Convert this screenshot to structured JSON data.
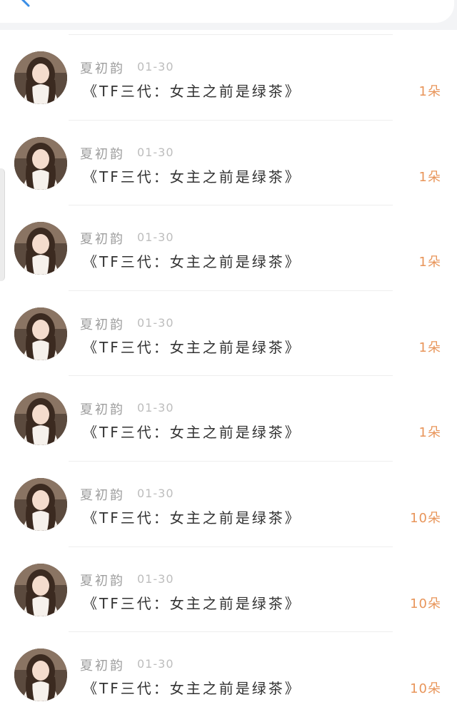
{
  "colors": {
    "accent_orange": "#e8955a",
    "name_gray": "#9e9e9e",
    "title_dark": "#333333",
    "back_arrow_blue": "#3a8ee6"
  },
  "icons": {
    "back": "back-arrow-icon"
  },
  "items": [
    {
      "username": "夏初韵",
      "date": "01-30",
      "title": "《TF三代：女主之前是绿茶》",
      "count": "1朵"
    },
    {
      "username": "夏初韵",
      "date": "01-30",
      "title": "《TF三代：女主之前是绿茶》",
      "count": "1朵"
    },
    {
      "username": "夏初韵",
      "date": "01-30",
      "title": "《TF三代：女主之前是绿茶》",
      "count": "1朵"
    },
    {
      "username": "夏初韵",
      "date": "01-30",
      "title": "《TF三代：女主之前是绿茶》",
      "count": "1朵"
    },
    {
      "username": "夏初韵",
      "date": "01-30",
      "title": "《TF三代：女主之前是绿茶》",
      "count": "1朵"
    },
    {
      "username": "夏初韵",
      "date": "01-30",
      "title": "《TF三代：女主之前是绿茶》",
      "count": "10朵"
    },
    {
      "username": "夏初韵",
      "date": "01-30",
      "title": "《TF三代：女主之前是绿茶》",
      "count": "10朵"
    },
    {
      "username": "夏初韵",
      "date": "01-30",
      "title": "《TF三代：女主之前是绿茶》",
      "count": "10朵"
    }
  ]
}
